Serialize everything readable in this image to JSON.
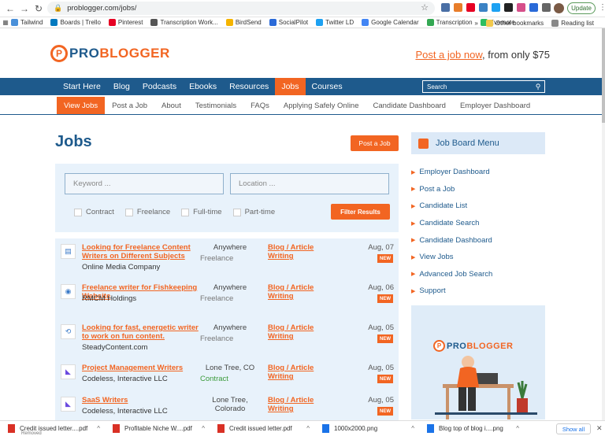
{
  "browser": {
    "url": "problogger.com/jobs/",
    "update_label": "Update",
    "bookmarks": [
      {
        "label": "Tailwind",
        "color": "#4a90d9"
      },
      {
        "label": "Boards | Trello",
        "color": "#0079bf"
      },
      {
        "label": "Pinterest",
        "color": "#e60023"
      },
      {
        "label": "Transcription Work...",
        "color": "#555555"
      },
      {
        "label": "BirdSend",
        "color": "#f5b400"
      },
      {
        "label": "SocialPilot",
        "color": "#2a6ad8"
      },
      {
        "label": "Twitter LD",
        "color": "#1da1f2"
      },
      {
        "label": "Google Calendar",
        "color": "#4285f4"
      },
      {
        "label": "Transcription",
        "color": "#34a853"
      },
      {
        "label": "Evernote",
        "color": "#2dbe60"
      }
    ],
    "other_bookmarks": "Other bookmarks",
    "reading_list": "Reading list",
    "more": "»"
  },
  "header": {
    "logo_pro": "PRO",
    "logo_blogger": "BLOGGER",
    "cta_link": "Post a job now",
    "cta_rest": ", from only $75"
  },
  "primary_nav": {
    "items": [
      "Start Here",
      "Blog",
      "Podcasts",
      "Ebooks",
      "Resources",
      "Jobs",
      "Courses"
    ],
    "active": "Jobs",
    "search_placeholder": "Search"
  },
  "sub_nav": {
    "items": [
      "View Jobs",
      "Post a Job",
      "About",
      "Testimonials",
      "FAQs",
      "Applying Safely Online",
      "Candidate Dashboard",
      "Employer Dashboard"
    ],
    "active": "View Jobs"
  },
  "main": {
    "title": "Jobs",
    "post_job_button": "Post a Job",
    "filter": {
      "keyword_placeholder": "Keyword ...",
      "location_placeholder": "Location ...",
      "types": [
        "Contract",
        "Freelance",
        "Full-time",
        "Part-time"
      ],
      "button": "Filter Results"
    },
    "jobs": [
      {
        "title": "Looking for Freelance Content Writers on Different Subjects",
        "company": "Online Media Company",
        "location": "Anywhere",
        "type": "Freelance",
        "category": "Blog / Article Writing",
        "date": "Aug, 07",
        "new": "NEW"
      },
      {
        "title": "Freelance writer for Fishkeeping Website",
        "company": "RMCM Holdings",
        "location": "Anywhere",
        "type": "Freelance",
        "category": "Blog / Article Writing",
        "date": "Aug, 06",
        "new": "NEW"
      },
      {
        "title": "Looking for fast, energetic writer to work on fun content.",
        "company": "SteadyContent.com",
        "location": "Anywhere",
        "type": "Freelance",
        "category": "Blog / Article Writing",
        "date": "Aug, 05",
        "new": "NEW"
      },
      {
        "title": "Project Management Writers",
        "company": "Codeless, Interactive LLC",
        "location": "Lone Tree, CO",
        "type": "Contract",
        "category": "Blog / Article Writing",
        "date": "Aug, 05",
        "new": "NEW"
      },
      {
        "title": "SaaS Writers",
        "company": "Codeless, Interactive LLC",
        "location": "Lone Tree, Colorado",
        "type": "",
        "category": "Blog / Article Writing",
        "date": "Aug, 05",
        "new": "NEW"
      }
    ]
  },
  "sidebar": {
    "menu_title": "Job Board Menu",
    "links": [
      "Employer Dashboard",
      "Post a Job",
      "Candidate List",
      "Candidate Search",
      "Candidate Dashboard",
      "View Jobs",
      "Advanced Job Search",
      "Support"
    ],
    "ad_logo_pro": "PRO",
    "ad_logo_blogger": "BLOGGER"
  },
  "downloads": {
    "items": [
      {
        "name": "Credit issued letter....pdf",
        "sub": "Removed",
        "color": "#d93025"
      },
      {
        "name": "Profitable Niche W....pdf",
        "sub": "",
        "color": "#d93025"
      },
      {
        "name": "Credit issued letter.pdf",
        "sub": "",
        "color": "#d93025"
      },
      {
        "name": "1000x2000.png",
        "sub": "",
        "color": "#1a73e8"
      },
      {
        "name": "Blog top of blog i....png",
        "sub": "",
        "color": "#1a73e8"
      }
    ],
    "show_all": "Show all"
  }
}
